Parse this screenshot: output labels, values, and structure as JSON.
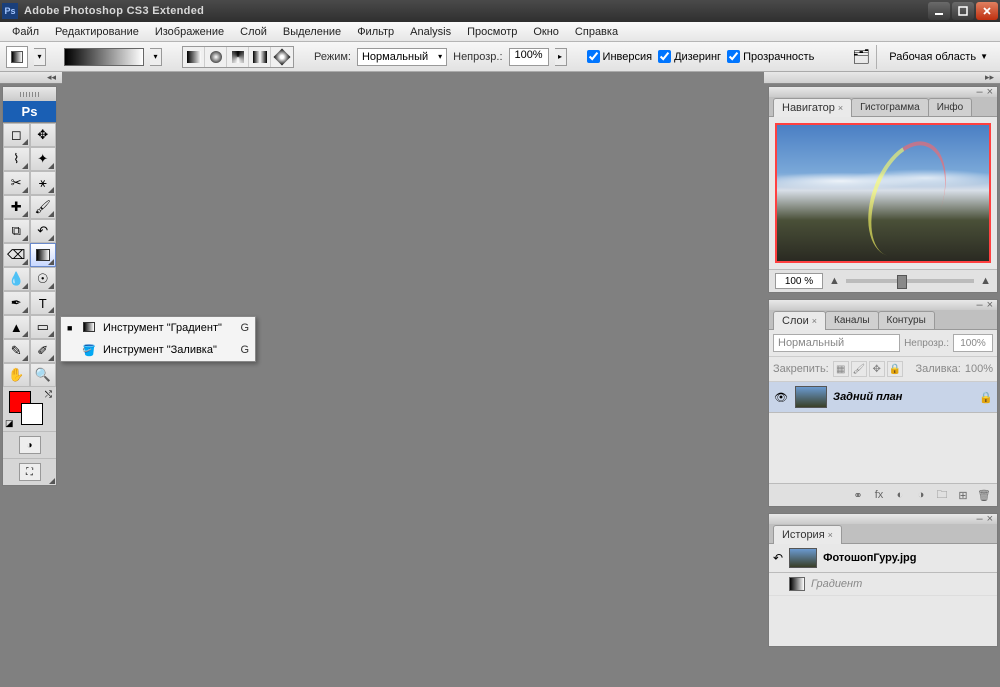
{
  "titlebar": {
    "title": "Adobe Photoshop CS3 Extended"
  },
  "menu": [
    "Файл",
    "Редактирование",
    "Изображение",
    "Слой",
    "Выделение",
    "Фильтр",
    "Analysis",
    "Просмотр",
    "Окно",
    "Справка"
  ],
  "options": {
    "mode_label": "Режим:",
    "mode_value": "Нормальный",
    "opacity_label": "Непрозр.:",
    "opacity_value": "100%",
    "chk_inverse": "Инверсия",
    "chk_dither": "Дизеринг",
    "chk_transparency": "Прозрачность",
    "workspace_label": "Рабочая область"
  },
  "flyout": {
    "items": [
      {
        "selected": true,
        "icon": "■",
        "label": "Инструмент \"Градиент\"",
        "shortcut": "G"
      },
      {
        "selected": false,
        "icon": "◍",
        "label": "Инструмент \"Заливка\"",
        "shortcut": "G"
      }
    ]
  },
  "navigator": {
    "tabs": [
      "Навигатор",
      "Гистограмма",
      "Инфо"
    ],
    "active_tab": 0,
    "zoom": "100 %"
  },
  "layers": {
    "tabs": [
      "Слои",
      "Каналы",
      "Контуры"
    ],
    "active_tab": 0,
    "blend_mode": "Нормальный",
    "opacity_label": "Непрозр.:",
    "opacity_value": "100%",
    "lock_label": "Закрепить:",
    "fill_label": "Заливка:",
    "fill_value": "100%",
    "layer_name": "Задний план"
  },
  "history": {
    "tabs": [
      "История"
    ],
    "filename": "ФотошопГуру.jpg",
    "step": "Градиент"
  },
  "tools": {
    "logo": "Ps",
    "fg_color": "#ff0000",
    "bg_color": "#ffffff"
  }
}
